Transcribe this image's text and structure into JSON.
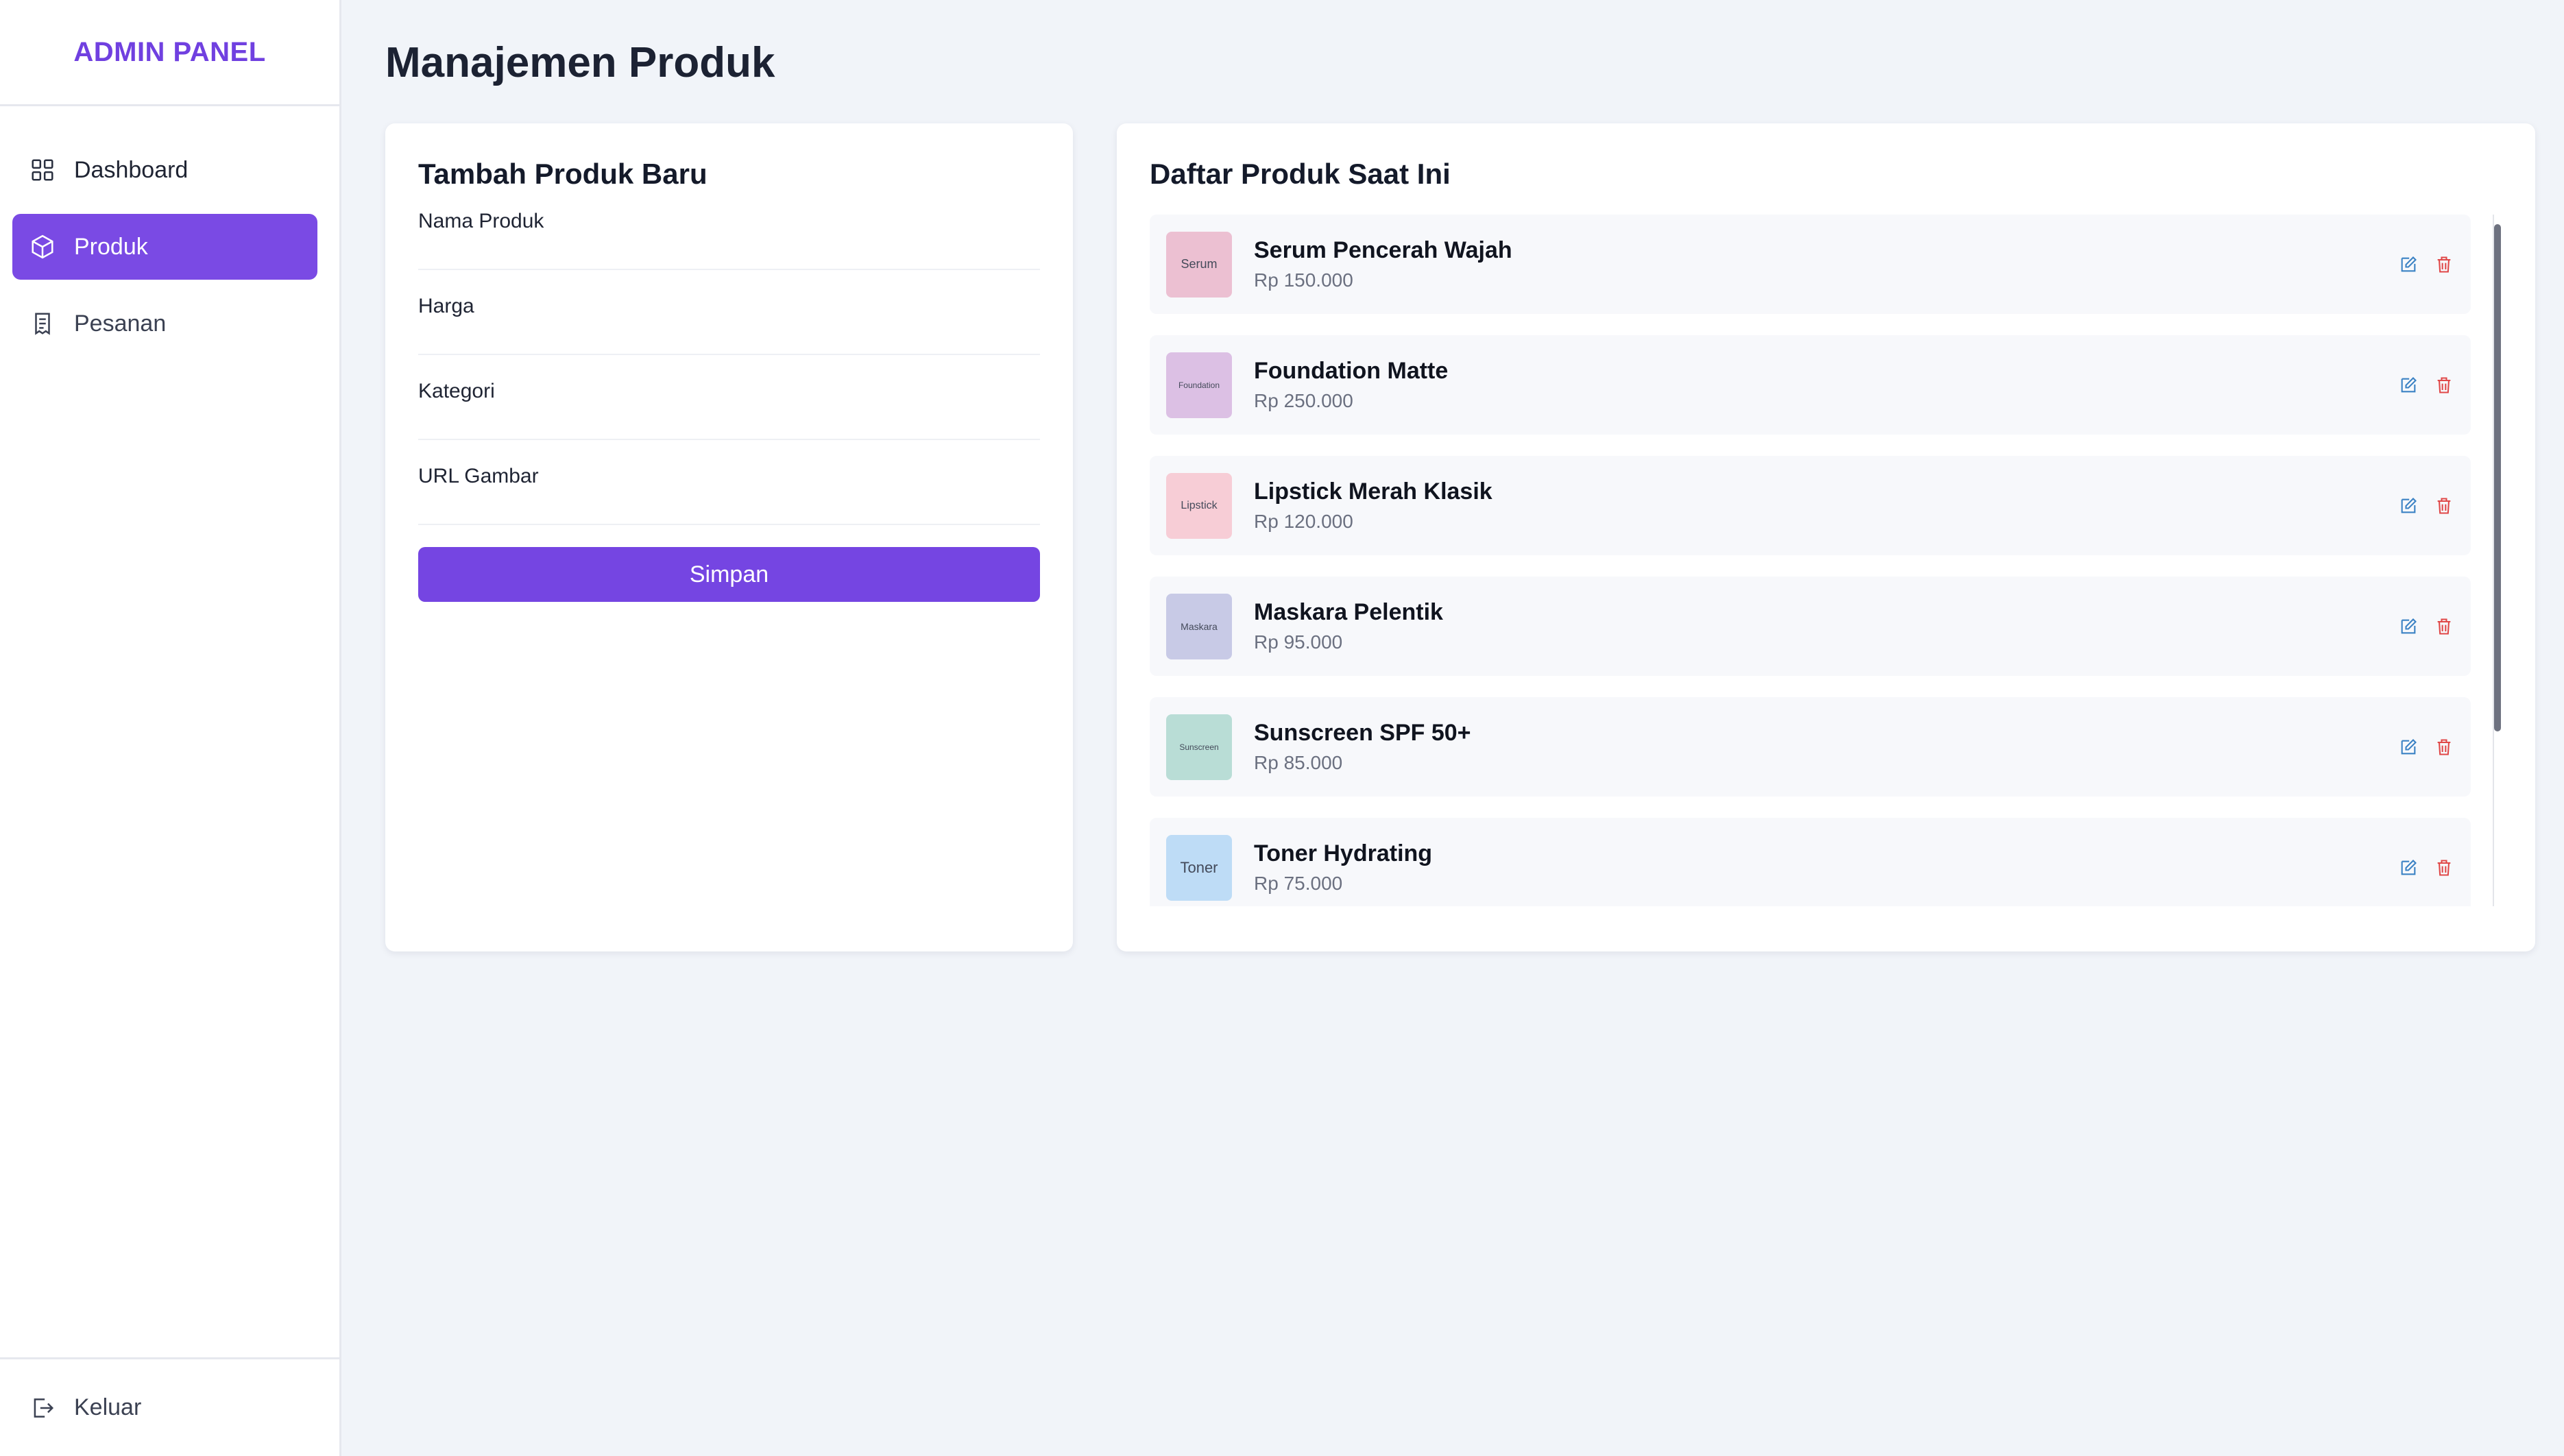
{
  "sidebar": {
    "brand": "ADMIN PANEL",
    "items": [
      {
        "label": "Dashboard",
        "icon": "grid-icon",
        "active": false
      },
      {
        "label": "Produk",
        "icon": "box-icon",
        "active": true
      },
      {
        "label": "Pesanan",
        "icon": "receipt-icon",
        "active": false
      }
    ],
    "logout": {
      "label": "Keluar",
      "icon": "logout-icon"
    }
  },
  "page": {
    "title": "Manajemen Produk"
  },
  "form": {
    "title": "Tambah Produk Baru",
    "fields": [
      {
        "label": "Nama Produk",
        "value": "",
        "placeholder": ""
      },
      {
        "label": "Harga",
        "value": "",
        "placeholder": ""
      },
      {
        "label": "Kategori",
        "value": "",
        "placeholder": ""
      },
      {
        "label": "URL Gambar",
        "value": "",
        "placeholder": ""
      }
    ],
    "submit_label": "Simpan"
  },
  "list": {
    "title": "Daftar Produk Saat Ini",
    "products": [
      {
        "name": "Serum Pencerah Wajah",
        "price": "Rp 150.000",
        "thumb_text": "Serum",
        "thumb_color": "#ecc0d2"
      },
      {
        "name": "Foundation Matte",
        "price": "Rp 250.000",
        "thumb_text": "Foundation",
        "thumb_color": "#dcc0e4"
      },
      {
        "name": "Lipstick Merah Klasik",
        "price": "Rp 120.000",
        "thumb_text": "Lipstick",
        "thumb_color": "#f7cdd6"
      },
      {
        "name": "Maskara Pelentik",
        "price": "Rp 95.000",
        "thumb_text": "Maskara",
        "thumb_color": "#c8cae6"
      },
      {
        "name": "Sunscreen SPF 50+",
        "price": "Rp 85.000",
        "thumb_text": "Sunscreen",
        "thumb_color": "#b9ddd6"
      },
      {
        "name": "Toner Hydrating",
        "price": "Rp 75.000",
        "thumb_text": "Toner",
        "thumb_color": "#bedcf6"
      }
    ]
  },
  "colors": {
    "accent": "#7545e2",
    "edit": "#3b82c4",
    "delete": "#e04848"
  }
}
